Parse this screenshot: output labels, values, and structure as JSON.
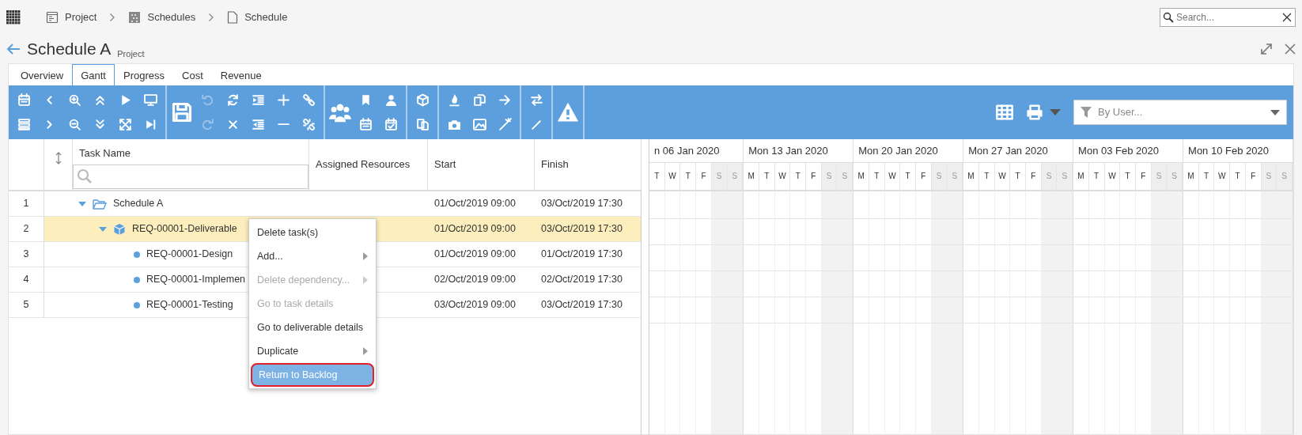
{
  "breadcrumb": [
    {
      "label": "Project",
      "kind": "project"
    },
    {
      "label": "Schedules",
      "kind": "schedules"
    },
    {
      "label": "Schedule",
      "kind": "schedule"
    }
  ],
  "search": {
    "placeholder": "Search..."
  },
  "title": "Schedule A",
  "subtitle": "Project",
  "tabs": [
    {
      "label": "Overview",
      "selected": false
    },
    {
      "label": "Gantt",
      "selected": true
    },
    {
      "label": "Progress",
      "selected": false
    },
    {
      "label": "Cost",
      "selected": false
    },
    {
      "label": "Revenue",
      "selected": false
    }
  ],
  "toolbar": {
    "groups": [
      {
        "buttons": [
          {
            "disabled": false
          },
          {
            "disabled": false
          },
          {
            "disabled": false
          },
          {
            "disabled": false
          },
          {
            "disabled": false
          },
          {
            "disabled": false
          },
          {
            "disabled": false
          },
          {
            "disabled": false
          },
          {
            "disabled": false
          },
          {
            "disabled": false
          },
          {
            "disabled": false
          },
          {
            "disabled": false
          }
        ]
      },
      {
        "buttons": [
          {
            "disabled": false
          },
          {
            "disabled": true
          },
          {
            "disabled": true
          },
          {
            "disabled": false
          },
          {
            "disabled": false
          },
          {
            "disabled": false
          },
          {
            "disabled": false
          },
          {
            "disabled": false
          },
          {
            "disabled": false
          },
          {
            "disabled": false
          },
          {
            "disabled": false
          }
        ]
      },
      {
        "buttons": [
          {
            "disabled": false
          },
          {
            "disabled": false
          },
          {
            "disabled": false
          },
          {
            "disabled": false
          },
          {
            "disabled": false
          }
        ]
      },
      {
        "buttons": [
          {
            "disabled": false
          },
          {
            "disabled": false
          }
        ]
      },
      {
        "buttons": [
          {
            "disabled": false
          },
          {
            "disabled": false
          },
          {
            "disabled": false
          },
          {
            "disabled": false
          },
          {
            "disabled": false
          },
          {
            "disabled": false
          }
        ]
      },
      {
        "buttons": [
          {
            "disabled": false
          },
          {
            "disabled": false
          }
        ]
      },
      {
        "buttons": [
          {
            "disabled": false
          }
        ]
      }
    ]
  },
  "filter": {
    "placeholder": "By User..."
  },
  "table": {
    "columns": [
      "Task Name",
      "Assigned Resources",
      "Start",
      "Finish"
    ],
    "rows": [
      {
        "number": "1",
        "name": "Schedule A",
        "kind": "folder",
        "expanded": true,
        "selected": false,
        "start": "01/Oct/2019 09:00",
        "finish": "03/Oct/2019 17:30",
        "children": [
          {
            "number": "2",
            "name": "REQ-00001-Deliverable",
            "kind": "deliverable",
            "expanded": true,
            "selected": true,
            "start": "01/Oct/2019 09:00",
            "finish": "03/Oct/2019 17:30",
            "children": [
              {
                "number": "3",
                "name": "REQ-00001-Design",
                "kind": "task",
                "selected": false,
                "start": "01/Oct/2019 09:00",
                "finish": "01/Oct/2019 17:30"
              },
              {
                "number": "4",
                "name": "REQ-00001-Implemen",
                "kind": "task",
                "selected": false,
                "start": "02/Oct/2019 09:00",
                "finish": "02/Oct/2019 17:30"
              },
              {
                "number": "5",
                "name": "REQ-00001-Testing",
                "kind": "task",
                "selected": false,
                "start": "03/Oct/2019 09:00",
                "finish": "03/Oct/2019 17:30"
              }
            ]
          }
        ]
      }
    ]
  },
  "gantt": {
    "weeks": [
      {
        "label": "n 06 Jan 2020",
        "days": [
          {
            "label": "T",
            "weekend": false
          },
          {
            "label": "W",
            "weekend": false
          },
          {
            "label": "T",
            "weekend": false
          },
          {
            "label": "F",
            "weekend": false
          },
          {
            "label": "S",
            "weekend": true
          },
          {
            "label": "S",
            "weekend": true
          }
        ]
      },
      {
        "label": "Mon 13 Jan 2020",
        "days": [
          {
            "label": "M",
            "weekend": false
          },
          {
            "label": "T",
            "weekend": false
          },
          {
            "label": "W",
            "weekend": false
          },
          {
            "label": "T",
            "weekend": false
          },
          {
            "label": "F",
            "weekend": false
          },
          {
            "label": "S",
            "weekend": true
          },
          {
            "label": "S",
            "weekend": true
          }
        ]
      },
      {
        "label": "Mon 20 Jan 2020",
        "days": [
          {
            "label": "M",
            "weekend": false
          },
          {
            "label": "T",
            "weekend": false
          },
          {
            "label": "W",
            "weekend": false
          },
          {
            "label": "T",
            "weekend": false
          },
          {
            "label": "F",
            "weekend": false
          },
          {
            "label": "S",
            "weekend": true
          },
          {
            "label": "S",
            "weekend": true
          }
        ]
      },
      {
        "label": "Mon 27 Jan 2020",
        "days": [
          {
            "label": "M",
            "weekend": false
          },
          {
            "label": "T",
            "weekend": false
          },
          {
            "label": "W",
            "weekend": false
          },
          {
            "label": "T",
            "weekend": false
          },
          {
            "label": "F",
            "weekend": false
          },
          {
            "label": "S",
            "weekend": true
          },
          {
            "label": "S",
            "weekend": true
          }
        ]
      },
      {
        "label": "Mon 03 Feb 2020",
        "days": [
          {
            "label": "M",
            "weekend": false
          },
          {
            "label": "T",
            "weekend": false
          },
          {
            "label": "W",
            "weekend": false
          },
          {
            "label": "T",
            "weekend": false
          },
          {
            "label": "F",
            "weekend": false
          },
          {
            "label": "S",
            "weekend": true
          },
          {
            "label": "S",
            "weekend": true
          }
        ]
      },
      {
        "label": "Mon 10 Feb 2020",
        "days": [
          {
            "label": "M",
            "weekend": false
          },
          {
            "label": "T",
            "weekend": false
          },
          {
            "label": "W",
            "weekend": false
          },
          {
            "label": "T",
            "weekend": false
          },
          {
            "label": "F",
            "weekend": false
          },
          {
            "label": "S",
            "weekend": true
          },
          {
            "label": "S",
            "weekend": true
          }
        ]
      }
    ]
  },
  "context_menu": {
    "items": [
      {
        "label": "Delete task(s)",
        "disabled": false,
        "submenu": false,
        "selected": false
      },
      {
        "label": "Add...",
        "disabled": false,
        "submenu": true,
        "selected": false
      },
      {
        "label": "Delete dependency...",
        "disabled": true,
        "submenu": true,
        "selected": false
      },
      {
        "label": "Go to task details",
        "disabled": true,
        "submenu": false,
        "selected": false
      },
      {
        "label": "Go to deliverable details",
        "disabled": false,
        "submenu": false,
        "selected": false
      },
      {
        "label": "Duplicate",
        "disabled": false,
        "submenu": true,
        "selected": false
      },
      {
        "label": "Return to Backlog",
        "disabled": false,
        "submenu": false,
        "selected": true
      }
    ]
  }
}
